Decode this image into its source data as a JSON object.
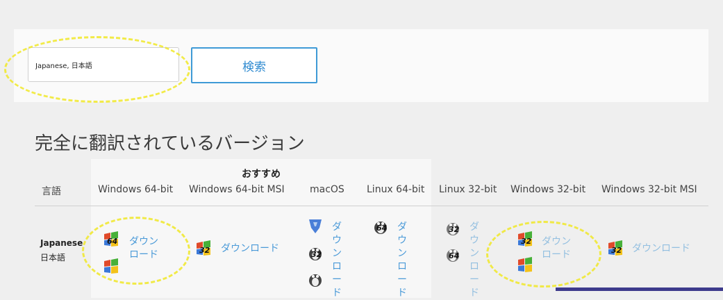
{
  "search": {
    "value": "Japanese, 日本語",
    "button_label": "検索"
  },
  "section": {
    "title": "完全に翻訳されているバージョン"
  },
  "table": {
    "recommended_label": "おすすめ",
    "headers": {
      "language": "言語",
      "win64": "Windows 64-bit",
      "win64msi": "Windows 64-bit MSI",
      "macos": "macOS",
      "linux64": "Linux 64-bit",
      "linux32": "Linux 32-bit",
      "win32": "Windows 32-bit",
      "win32msi": "Windows 32-bit MSI"
    },
    "row": {
      "language": "Japanese",
      "native": "日本語",
      "links": {
        "win64": "ダウンロード",
        "win64msi": "ダウンロード",
        "macos": "ダウンロード",
        "linux64": "ダウンロード",
        "linux32": "ダウンロード",
        "win32": "ダウンロード",
        "win32msi": "ダウンロード"
      },
      "badges": {
        "b64": "64",
        "b32": "32"
      }
    }
  },
  "icons": {
    "windows": "windows-icon",
    "apple": "apple-icon",
    "linux": "linux-icon"
  },
  "colors": {
    "link": "#4a9ad8",
    "button_border": "#3e9ad6",
    "highlight": "#f0e828"
  }
}
